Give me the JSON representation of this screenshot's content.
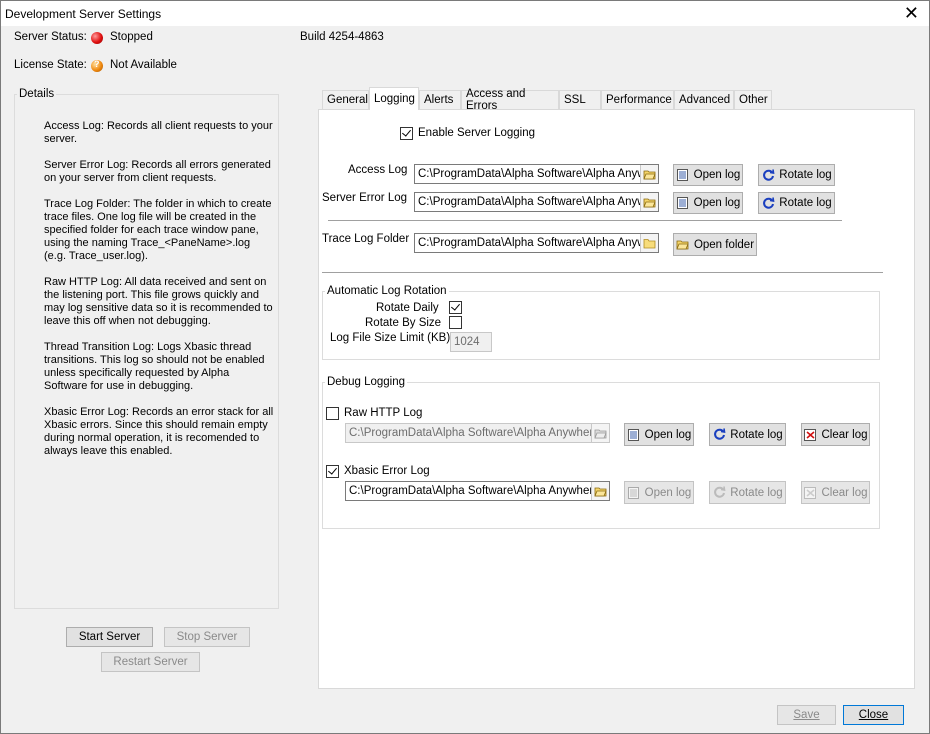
{
  "window": {
    "title": "Development Server Settings"
  },
  "status": {
    "server_status_label": "Server Status:",
    "server_status_value": "Stopped",
    "license_label": "License State:",
    "license_value": "Not Available",
    "build": "Build 4254-4863"
  },
  "details": {
    "legend": "Details",
    "paragraphs": [
      "Access Log: Records all client requests to your server.",
      "Server Error Log: Records all errors generated on your server from client requests.",
      "Trace Log Folder: The folder in which to create trace files. One log file will be created in the specified folder for each trace window pane, using the naming Trace_<PaneName>.log (e.g. Trace_user.log).",
      "Raw HTTP Log: All data received and sent on the listening port. This file grows quickly and may log sensitive data so it is recommended to leave this off when not debugging.",
      "Thread Transition Log: Logs Xbasic thread transitions. This log so should not be enabled unless specifically requested by Alpha Software for use in debugging.",
      "Xbasic Error Log: Records an error stack for all Xbasic errors. Since this should remain empty during normal operation, it is recomended to always leave this enabled."
    ]
  },
  "server_buttons": {
    "start": "Start Server",
    "stop": "Stop Server",
    "restart": "Restart Server"
  },
  "tabs": [
    "General",
    "Logging",
    "Alerts",
    "Access and Errors",
    "SSL",
    "Performance",
    "Advanced",
    "Other"
  ],
  "active_tab": "Logging",
  "logging": {
    "enable_label": "Enable Server Logging",
    "enable_checked": true,
    "access_log_label": "Access Log",
    "access_log_path": "C:\\ProgramData\\Alpha Software\\Alpha Anywh",
    "error_log_label": "Server Error Log",
    "error_log_path": "C:\\ProgramData\\Alpha Software\\Alpha Anywh",
    "trace_label": "Trace Log Folder",
    "trace_path": "C:\\ProgramData\\Alpha Software\\Alpha Anywh",
    "open_log": "Open log",
    "rotate_log": "Rotate log",
    "open_folder": "Open folder",
    "clear_log": "Clear log"
  },
  "rotation": {
    "legend": "Automatic Log Rotation",
    "rotate_daily_label": "Rotate Daily",
    "rotate_daily_checked": true,
    "rotate_size_label": "Rotate By Size",
    "rotate_size_checked": false,
    "size_limit_label": "Log File Size Limit (KB)",
    "size_limit_value": "1024"
  },
  "debug": {
    "legend": "Debug Logging",
    "raw_http_label": "Raw HTTP Log",
    "raw_http_checked": false,
    "raw_http_path": "C:\\ProgramData\\Alpha Software\\Alpha Anywhere",
    "xbasic_label": "Xbasic Error Log",
    "xbasic_checked": true,
    "xbasic_path": "C:\\ProgramData\\Alpha Software\\Alpha Anywhere"
  },
  "footer": {
    "save": "Save",
    "close": "Close"
  },
  "colors": {
    "stopped": "#e01010",
    "license": "#f08a10",
    "accent": "#1a3fbf"
  },
  "icons": {
    "open_log": "log-file-icon",
    "rotate": "rotate-icon",
    "folder": "folder-icon",
    "browse": "folder-browse-icon",
    "clear": "clear-log-icon"
  }
}
